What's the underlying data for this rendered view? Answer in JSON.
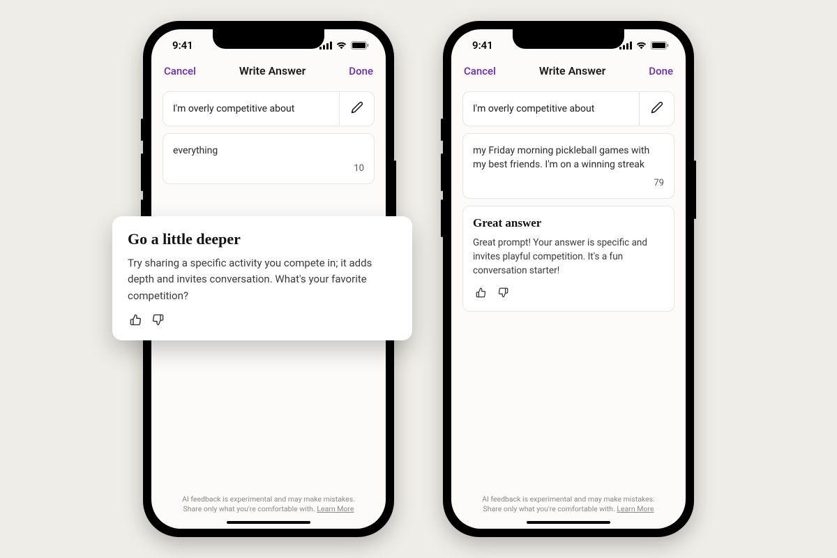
{
  "status": {
    "time": "9:41"
  },
  "nav": {
    "cancel": "Cancel",
    "title": "Write Answer",
    "done": "Done"
  },
  "prompt": "I'm overly competitive about",
  "phone1": {
    "answer": "everything",
    "count": "10",
    "feedback": {
      "title": "Go a little deeper",
      "body": "Try sharing a specific activity you compete in; it adds depth and invites conversation. What's your favorite competition?"
    }
  },
  "phone2": {
    "answer": "my Friday morning pickleball games with my best friends. I'm on a winning streak",
    "count": "79",
    "feedback": {
      "title": "Great answer",
      "body": "Great prompt! Your answer is specific and invites playful competition. It's a fun conversation starter!"
    }
  },
  "disclaimer": {
    "text": "AI feedback is experimental and may make mistakes. Share only what you're comfortable with. ",
    "link": "Learn More"
  }
}
